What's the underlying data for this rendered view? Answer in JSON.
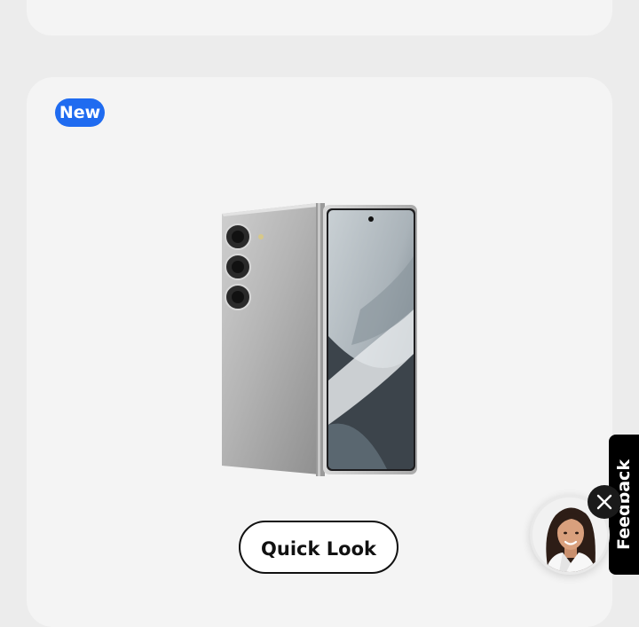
{
  "product_card": {
    "badge": "New",
    "product_image": "silver-foldable-phone",
    "quick_look_label": "Quick Look"
  },
  "feedback": {
    "tab_label": "Feedback",
    "assistant_avatar": "assistant-woman-avatar",
    "close_icon": "close-icon"
  },
  "colors": {
    "badge": "#1f6bf0",
    "card_background": "#f4f4f4",
    "page_background": "#ececec",
    "feedback_tab": "#000000"
  }
}
